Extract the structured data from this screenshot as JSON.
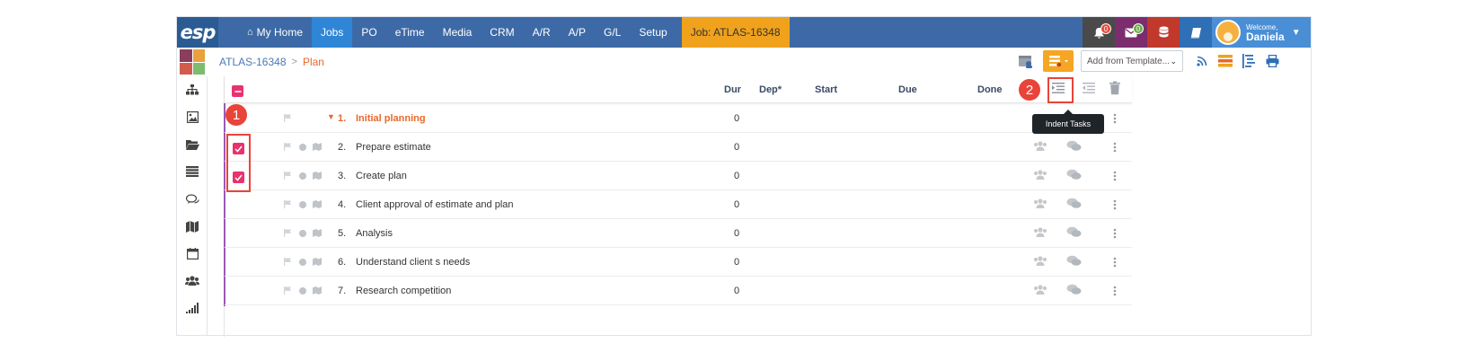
{
  "nav": {
    "logo": "esp",
    "items": [
      "My Home",
      "Jobs",
      "PO",
      "eTime",
      "Media",
      "CRM",
      "A/R",
      "A/P",
      "G/L",
      "Setup"
    ],
    "active": "Jobs",
    "job_label": "Job: ATLAS-16348",
    "notifications_count": "0",
    "messages_count": "0",
    "welcome_label": "Welcome,",
    "user_name": "Daniela",
    "colors": {
      "bar": "#3d6aa6",
      "active": "#2f86d6",
      "job": "#f0a21c",
      "bell_box": "#4a4a4a",
      "mail_box": "#7b2d6d",
      "db_box": "#c0392b",
      "book_box": "#2f6fb5"
    }
  },
  "breadcrumb": {
    "job": "ATLAS-16348",
    "separator": ">",
    "current": "Plan"
  },
  "toolbar": {
    "template_placeholder": "Add from Template..."
  },
  "table": {
    "headers": {
      "dur": "Dur",
      "dep": "Dep*",
      "start": "Start",
      "due": "Due",
      "done": "Done"
    },
    "rows": [
      {
        "num": "1.",
        "name": "Initial planning",
        "dur": "0",
        "parent": true,
        "checked": false
      },
      {
        "num": "2.",
        "name": "Prepare estimate",
        "dur": "0",
        "parent": false,
        "checked": true
      },
      {
        "num": "3.",
        "name": "Create plan",
        "dur": "0",
        "parent": false,
        "checked": true
      },
      {
        "num": "4.",
        "name": "Client approval of estimate and plan",
        "dur": "0",
        "parent": false,
        "checked": false
      },
      {
        "num": "5.",
        "name": "Analysis",
        "dur": "0",
        "parent": false,
        "checked": false
      },
      {
        "num": "6.",
        "name": "Understand client s needs",
        "dur": "0",
        "parent": false,
        "checked": false
      },
      {
        "num": "7.",
        "name": "Research competition",
        "dur": "0",
        "parent": false,
        "checked": false
      }
    ]
  },
  "tooltip": "Indent Tasks",
  "callouts": [
    "1",
    "2"
  ]
}
